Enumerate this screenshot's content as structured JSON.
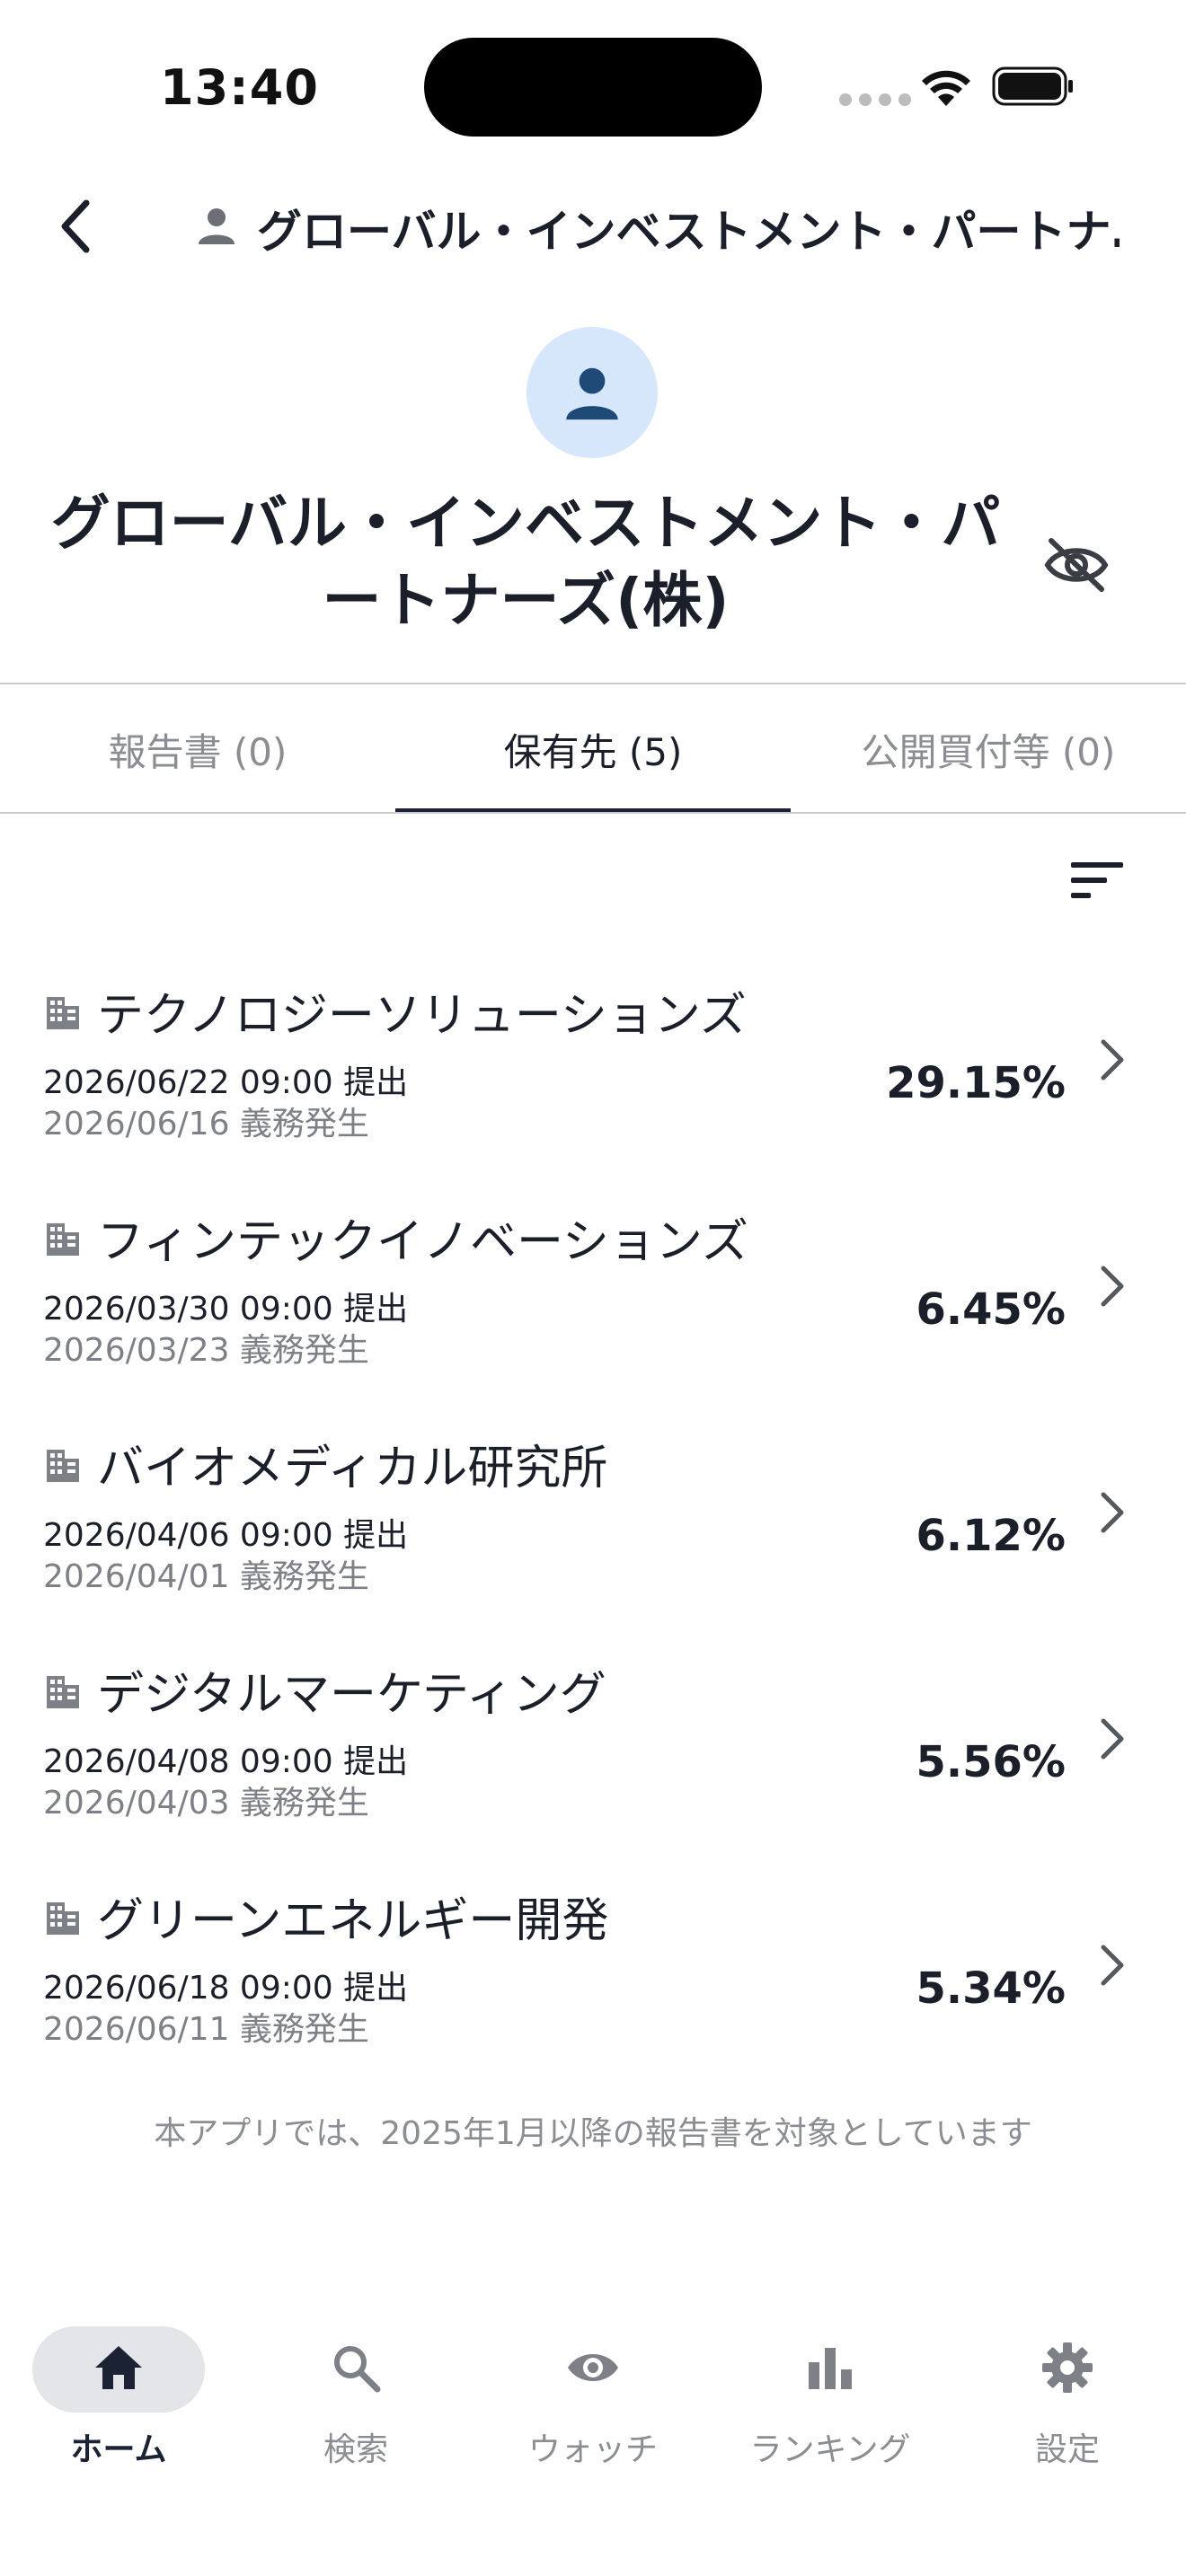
{
  "status_bar": {
    "time": "13:40"
  },
  "header": {
    "title": "グローバル・インベストメント・パートナ…"
  },
  "profile": {
    "name": "グローバル・インベストメント・パートナーズ(株)"
  },
  "tabs": [
    {
      "label": "報告書 (0)",
      "active": false
    },
    {
      "label": "保有先 (5)",
      "active": true
    },
    {
      "label": "公開買付等 (0)",
      "active": false
    }
  ],
  "holdings": [
    {
      "company": "テクノロジーソリューションズ",
      "filed": "2026/06/22 09:00 提出",
      "obligation": "2026/06/16 義務発生",
      "percent": "29.15%"
    },
    {
      "company": "フィンテックイノベーションズ",
      "filed": "2026/03/30 09:00 提出",
      "obligation": "2026/03/23 義務発生",
      "percent": "6.45%"
    },
    {
      "company": "バイオメディカル研究所",
      "filed": "2026/04/06 09:00 提出",
      "obligation": "2026/04/01 義務発生",
      "percent": "6.12%"
    },
    {
      "company": "デジタルマーケティング",
      "filed": "2026/04/08 09:00 提出",
      "obligation": "2026/04/03 義務発生",
      "percent": "5.56%"
    },
    {
      "company": "グリーンエネルギー開発",
      "filed": "2026/06/18 09:00 提出",
      "obligation": "2026/06/11 義務発生",
      "percent": "5.34%"
    }
  ],
  "footer_note": "本アプリでは、2025年1月以降の報告書を対象としています",
  "bottom_nav": [
    {
      "label": "ホーム",
      "icon": "home-icon",
      "active": true
    },
    {
      "label": "検索",
      "icon": "search-icon",
      "active": false
    },
    {
      "label": "ウォッチ",
      "icon": "eye-icon",
      "active": false
    },
    {
      "label": "ランキング",
      "icon": "bar-chart-icon",
      "active": false
    },
    {
      "label": "設定",
      "icon": "gear-icon",
      "active": false
    }
  ],
  "colors": {
    "accent": "#1b2233",
    "avatar_bg": "#d6e6fb",
    "avatar_fg": "#1f4a78",
    "muted": "#8a8d92"
  }
}
